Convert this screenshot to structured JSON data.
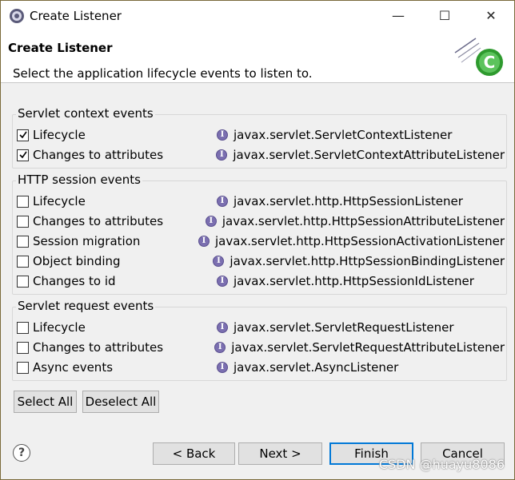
{
  "window": {
    "title": "Create Listener",
    "minimize_glyph": "—",
    "maximize_glyph": "☐",
    "close_glyph": "✕"
  },
  "banner": {
    "title": "Create Listener",
    "description": "Select the application lifecycle events to listen to."
  },
  "groups": [
    {
      "title": "Servlet context events",
      "items": [
        {
          "label": "Lifecycle",
          "checked": true,
          "interface": "javax.servlet.ServletContextListener"
        },
        {
          "label": "Changes to attributes",
          "checked": true,
          "interface": "javax.servlet.ServletContextAttributeListener"
        }
      ]
    },
    {
      "title": "HTTP session events",
      "items": [
        {
          "label": "Lifecycle",
          "checked": false,
          "interface": "javax.servlet.http.HttpSessionListener"
        },
        {
          "label": "Changes to attributes",
          "checked": false,
          "interface": "javax.servlet.http.HttpSessionAttributeListener"
        },
        {
          "label": "Session migration",
          "checked": false,
          "interface": "javax.servlet.http.HttpSessionActivationListener"
        },
        {
          "label": "Object binding",
          "checked": false,
          "interface": "javax.servlet.http.HttpSessionBindingListener"
        },
        {
          "label": "Changes to id",
          "checked": false,
          "interface": "javax.servlet.http.HttpSessionIdListener"
        }
      ]
    },
    {
      "title": "Servlet request events",
      "items": [
        {
          "label": "Lifecycle",
          "checked": false,
          "interface": "javax.servlet.ServletRequestListener"
        },
        {
          "label": "Changes to attributes",
          "checked": false,
          "interface": "javax.servlet.ServletRequestAttributeListener"
        },
        {
          "label": "Async events",
          "checked": false,
          "interface": "javax.servlet.AsyncListener"
        }
      ]
    }
  ],
  "interface_icon_glyph": "I",
  "selection": {
    "select_all": "Select All",
    "deselect_all": "Deselect All"
  },
  "footer": {
    "help_glyph": "?",
    "back": "< Back",
    "next": "Next >",
    "finish": "Finish",
    "cancel": "Cancel",
    "watermark": "CSDN @huayu8086"
  },
  "colors": {
    "default_button_border": "#0078d7",
    "interface_icon": "#7b6fb0"
  }
}
